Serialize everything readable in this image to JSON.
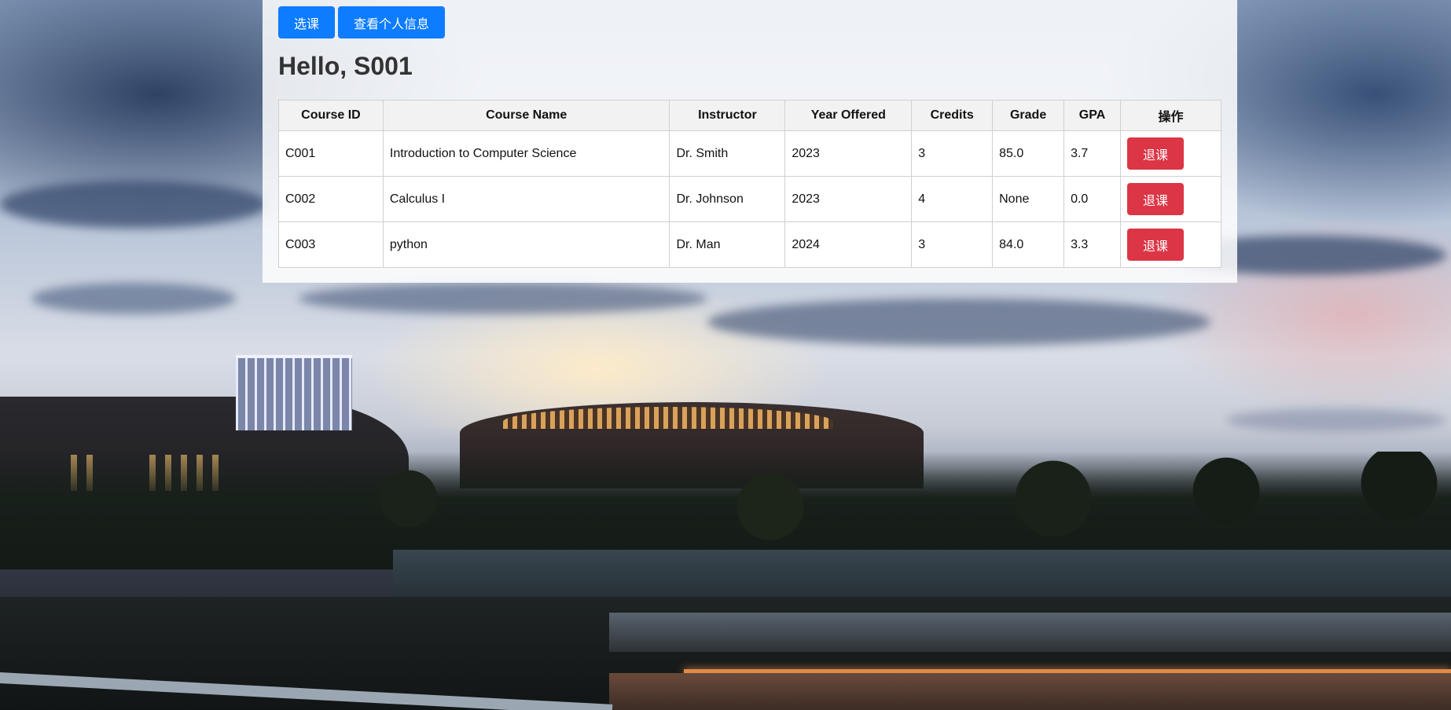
{
  "nav": {
    "select_course_label": "选课",
    "profile_label": "查看个人信息"
  },
  "greeting": "Hello, S001",
  "table": {
    "headers": [
      "Course ID",
      "Course Name",
      "Instructor",
      "Year Offered",
      "Credits",
      "Grade",
      "GPA",
      "操作"
    ],
    "rows": [
      {
        "course_id": "C001",
        "course_name": "Introduction to Computer Science",
        "instructor": "Dr. Smith",
        "year": "2023",
        "credits": "3",
        "grade": "85.0",
        "gpa": "3.7",
        "action": "退课"
      },
      {
        "course_id": "C002",
        "course_name": "Calculus I",
        "instructor": "Dr. Johnson",
        "year": "2023",
        "credits": "4",
        "grade": "None",
        "gpa": "0.0",
        "action": "退课"
      },
      {
        "course_id": "C003",
        "course_name": "python",
        "instructor": "Dr. Man",
        "year": "2024",
        "credits": "3",
        "grade": "84.0",
        "gpa": "3.3",
        "action": "退课"
      }
    ]
  },
  "colors": {
    "primary_button": "#0d7cff",
    "danger_button": "#dc3545",
    "panel_background": "rgba(255,255,255,0.85)",
    "header_background": "#f2f2f2"
  }
}
